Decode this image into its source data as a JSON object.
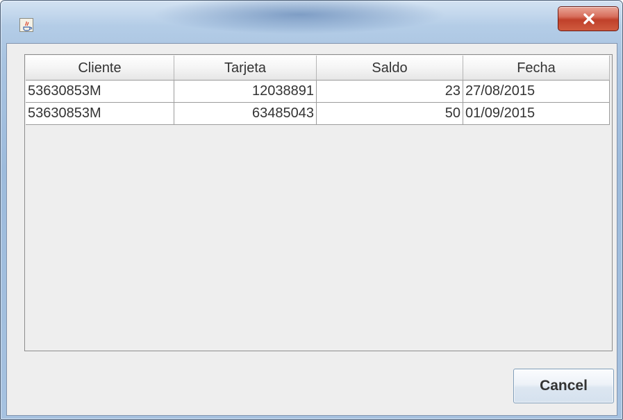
{
  "window": {
    "icon": "java-cup-icon",
    "close_icon": "close-icon",
    "accent_close": "#c0402a"
  },
  "table": {
    "columns": [
      "Cliente",
      "Tarjeta",
      "Saldo",
      "Fecha"
    ],
    "rows": [
      [
        "53630853M",
        "12038891",
        "23",
        "27/08/2015"
      ],
      [
        "53630853M",
        "63485043",
        "50",
        "01/09/2015"
      ]
    ]
  },
  "footer": {
    "cancel_label": "Cancel"
  }
}
